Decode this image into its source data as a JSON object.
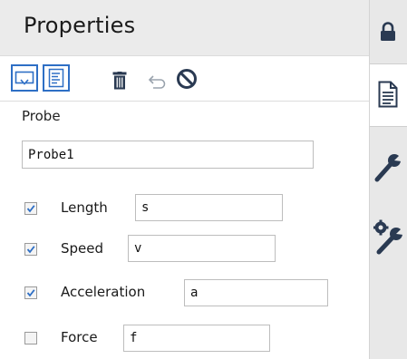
{
  "panel": {
    "title": "Properties"
  },
  "toolbar": {
    "items": [
      {
        "icon": "probe-view-icon",
        "selected": true
      },
      {
        "icon": "text-view-icon",
        "selected": true
      },
      {
        "icon": "trash-icon",
        "enabled": true
      },
      {
        "icon": "undo-icon",
        "enabled": false
      },
      {
        "icon": "disable-icon",
        "enabled": true
      }
    ]
  },
  "probe": {
    "section_label": "Probe",
    "name_value": "Probe1",
    "fields": [
      {
        "label": "Length",
        "checked": true,
        "value": "s"
      },
      {
        "label": "Speed",
        "checked": true,
        "value": "v"
      },
      {
        "label": "Acceleration",
        "checked": true,
        "value": "a"
      },
      {
        "label": "Force",
        "checked": false,
        "value": "f"
      }
    ]
  },
  "rail": {
    "tabs": [
      {
        "icon": "lock-icon",
        "active": false
      },
      {
        "icon": "document-icon",
        "active": true
      },
      {
        "icon": "wrench-icon",
        "active": false
      },
      {
        "icon": "wrench-gear-icon",
        "active": false
      }
    ]
  },
  "colors": {
    "accent": "#2e6fc5",
    "icon_dark": "#2a3a52",
    "header_bg": "#ebebeb",
    "rail_bg": "#e8e8e8"
  }
}
